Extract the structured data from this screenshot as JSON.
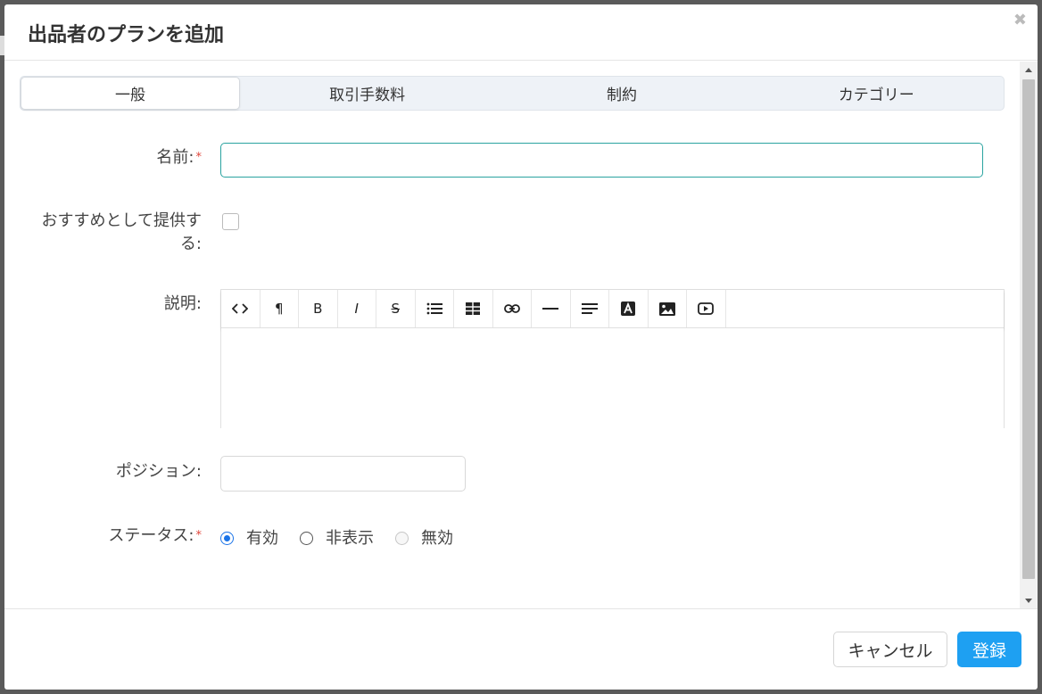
{
  "modal": {
    "title": "出品者のプランを追加",
    "close_icon": "close-icon"
  },
  "tabs": [
    {
      "label": "一般",
      "active": true
    },
    {
      "label": "取引手数料",
      "active": false
    },
    {
      "label": "制約",
      "active": false
    },
    {
      "label": "カテゴリー",
      "active": false
    }
  ],
  "form": {
    "name": {
      "label": "名前:",
      "required_mark": "*",
      "value": ""
    },
    "featured": {
      "label_line1": "おすすめとして提供す",
      "label_line2": "る:",
      "checked": false
    },
    "description": {
      "label": "説明:",
      "toolbar": [
        {
          "icon": "code-icon",
          "glyph": "<>"
        },
        {
          "icon": "paragraph-icon",
          "glyph": "¶"
        },
        {
          "icon": "bold-icon",
          "glyph": "B"
        },
        {
          "icon": "italic-icon",
          "glyph": "I"
        },
        {
          "icon": "strikethrough-icon",
          "glyph": "S"
        },
        {
          "icon": "unordered-list-icon",
          "glyph": ""
        },
        {
          "icon": "table-icon",
          "glyph": ""
        },
        {
          "icon": "link-icon",
          "glyph": ""
        },
        {
          "icon": "horizontal-rule-icon",
          "glyph": ""
        },
        {
          "icon": "align-icon",
          "glyph": ""
        },
        {
          "icon": "font-color-icon",
          "glyph": "A"
        },
        {
          "icon": "image-icon",
          "glyph": ""
        },
        {
          "icon": "video-icon",
          "glyph": ""
        }
      ],
      "value": ""
    },
    "position": {
      "label": "ポジション:",
      "value": ""
    },
    "status": {
      "label": "ステータス:",
      "required_mark": "*",
      "options": [
        {
          "label": "有効",
          "checked": true,
          "disabled": false
        },
        {
          "label": "非表示",
          "checked": false,
          "disabled": false
        },
        {
          "label": "無効",
          "checked": false,
          "disabled": true
        }
      ]
    }
  },
  "footer": {
    "cancel_label": "キャンセル",
    "submit_label": "登録"
  },
  "colors": {
    "accent": "#1ea0f2",
    "focus_border": "#2aa3a0",
    "required": "#e0453a",
    "radio_checked": "#1a73e8"
  }
}
